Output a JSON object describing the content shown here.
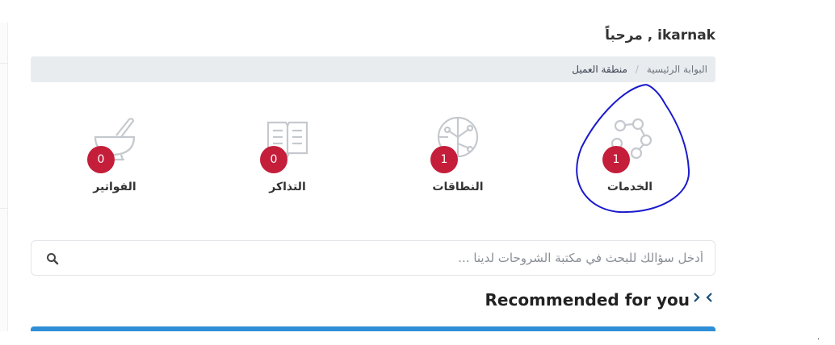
{
  "header": {
    "welcome": "مرحباً , ikarnak"
  },
  "breadcrumb": {
    "home": "البوابة الرئيسية",
    "separator": "/",
    "current": "منطقة العميل"
  },
  "tiles": [
    {
      "label": "الخدمات",
      "count": "1",
      "icon": "services-network-icon"
    },
    {
      "label": "النطاقات",
      "count": "1",
      "icon": "domains-globe-icon"
    },
    {
      "label": "التذاكر",
      "count": "0",
      "icon": "tickets-book-icon"
    },
    {
      "label": "الفواتير",
      "count": "0",
      "icon": "invoices-mortar-icon"
    }
  ],
  "search": {
    "placeholder": "أدخل سؤالك للبحث في مكتبة الشروحات لدينا ...",
    "value": ""
  },
  "recommended": {
    "title": "Recommended for you"
  },
  "corner": {
    "mark": "·"
  },
  "colors": {
    "badge": "#c41e3a",
    "accent_bar": "#2e8fd6",
    "annotation": "#1a1acc",
    "arrows": "#1d4f7c"
  }
}
